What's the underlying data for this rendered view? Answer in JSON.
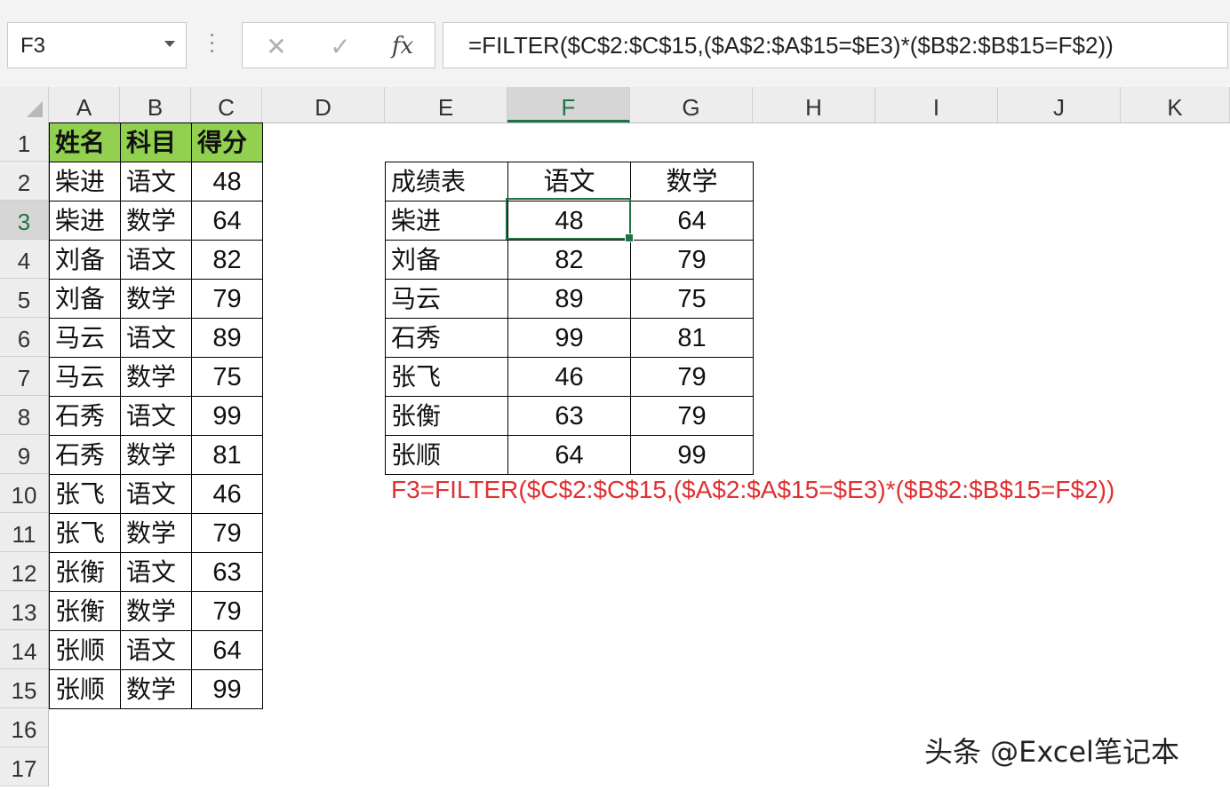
{
  "name_box": "F3",
  "formula_bar": {
    "cancel_icon": "✕",
    "enter_icon": "✓",
    "fx_label": "fx",
    "formula": "=FILTER($C$2:$C$15,($A$2:$A$15=$E3)*($B$2:$B$15=F$2))"
  },
  "columns": [
    "A",
    "B",
    "C",
    "D",
    "E",
    "F",
    "G",
    "H",
    "I",
    "J",
    "K"
  ],
  "rows": [
    "1",
    "2",
    "3",
    "4",
    "5",
    "6",
    "7",
    "8",
    "9",
    "10",
    "11",
    "12",
    "13",
    "14",
    "15",
    "16",
    "17"
  ],
  "active_cell": {
    "column": "F",
    "row": "3"
  },
  "source_table": {
    "headers": [
      "姓名",
      "科目",
      "得分"
    ],
    "rows": [
      [
        "柴进",
        "语文",
        "48"
      ],
      [
        "柴进",
        "数学",
        "64"
      ],
      [
        "刘备",
        "语文",
        "82"
      ],
      [
        "刘备",
        "数学",
        "79"
      ],
      [
        "马云",
        "语文",
        "89"
      ],
      [
        "马云",
        "数学",
        "75"
      ],
      [
        "石秀",
        "语文",
        "99"
      ],
      [
        "石秀",
        "数学",
        "81"
      ],
      [
        "张飞",
        "语文",
        "46"
      ],
      [
        "张飞",
        "数学",
        "79"
      ],
      [
        "张衡",
        "语文",
        "63"
      ],
      [
        "张衡",
        "数学",
        "79"
      ],
      [
        "张顺",
        "语文",
        "64"
      ],
      [
        "张顺",
        "数学",
        "99"
      ]
    ]
  },
  "result_table": {
    "headers": [
      "成绩表",
      "语文",
      "数学"
    ],
    "rows": [
      [
        "柴进",
        "48",
        "64"
      ],
      [
        "刘备",
        "82",
        "79"
      ],
      [
        "马云",
        "89",
        "75"
      ],
      [
        "石秀",
        "99",
        "81"
      ],
      [
        "张飞",
        "46",
        "79"
      ],
      [
        "张衡",
        "63",
        "79"
      ],
      [
        "张顺",
        "64",
        "99"
      ]
    ]
  },
  "formula_note": "F3=FILTER($C$2:$C$15,($A$2:$A$15=$E3)*($B$2:$B$15=F$2))",
  "watermark": "头条 @Excel笔记本",
  "colors": {
    "header_fill": "#92d050",
    "active": "#217346",
    "note": "#e03030"
  }
}
